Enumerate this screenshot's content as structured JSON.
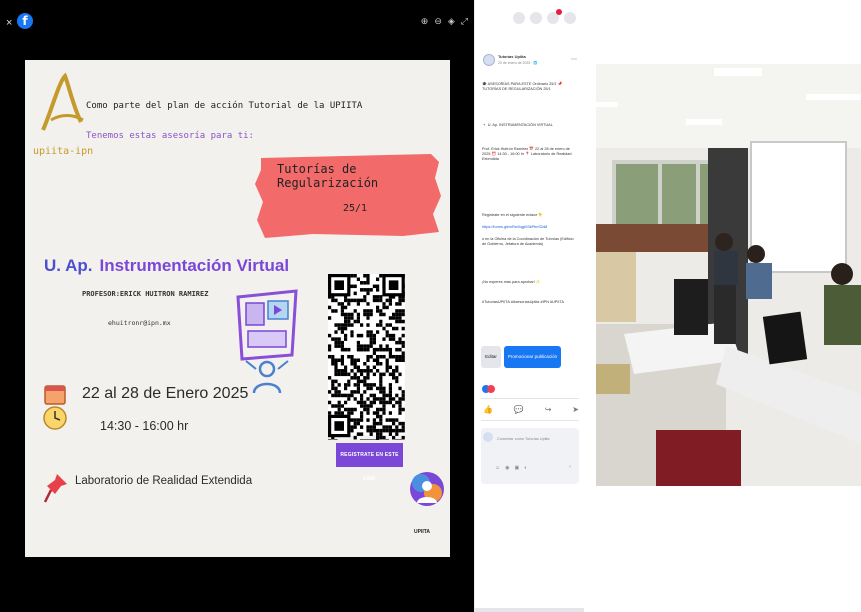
{
  "viewer": {
    "close_label": "×",
    "fb_label": "f",
    "tool_icons": [
      "zoom-in-icon",
      "zoom-out-icon",
      "tag-icon",
      "fullscreen-icon"
    ],
    "tool_glyphs": [
      "⊕",
      "⊖",
      "◈",
      "⤢"
    ]
  },
  "poster": {
    "logo_text": "upiita-ipn",
    "line1": "Como parte del plan de acción Tutorial de la UPIITA",
    "line2": "Tenemos estas asesoría para ti:",
    "banner_line1": "Tutorías de Regularización",
    "banner_line2": "25/1",
    "subject_prefix": "U. Ap.",
    "subject": "Instrumentación Virtual",
    "teacher": "PROFESOR:ERICK HUITRON RAMIREZ",
    "email": "ehuitronr@ipn.mx",
    "cta": "REGISTRATE EN ESTE LINK",
    "date": "22 al 28 de Enero 2025",
    "time": "14:30 - 16:00 hr",
    "location": "Laboratorio de Realidad Extendida",
    "badge_text": "UPIITA",
    "colors": {
      "purple": "#7a47d8",
      "banner": "#f26a6a",
      "gold": "#c49a2c"
    }
  },
  "sidebar": {
    "page_name": "Tutorías Upiita",
    "meta": "20 de enero de 2025 · 🌐",
    "text_blocks": [
      "🎓 ASESORÍAS PARA ESTE Ordinario 25/1 📌 TUTORÍAS DE REGULARIZACIÓN 25/1",
      "🔹 U. Ap. INSTRUMENTACIÓN VIRTUAL",
      "Prof. Erick Huitrón Ramírez 📅 22 al 28 de enero de 2025 ⏰ 14:30 - 16:00 hr 📍 Laboratorio de Realidad Extendida",
      "Regístrate en el siguiente enlace 👇",
      "https://forms.gle/nRwXqgM3kPbnS2d8",
      "o en la Oficina de la Coordinación de Tutorías (Edificio de Gobierno, Jefatura de Academia)",
      "¡No esperes más para aprobar! ✨",
      "#TutoríasUPIITA #AsesoríasUpiita #IPN #UPIITA"
    ],
    "edit_label": "Editar",
    "promo_label": "Promocionar publicación",
    "comment_placeholder": "Comentar como Tutorías Upiita",
    "action_icons": [
      "like-icon",
      "comment-icon",
      "share-icon",
      "send-icon"
    ]
  }
}
